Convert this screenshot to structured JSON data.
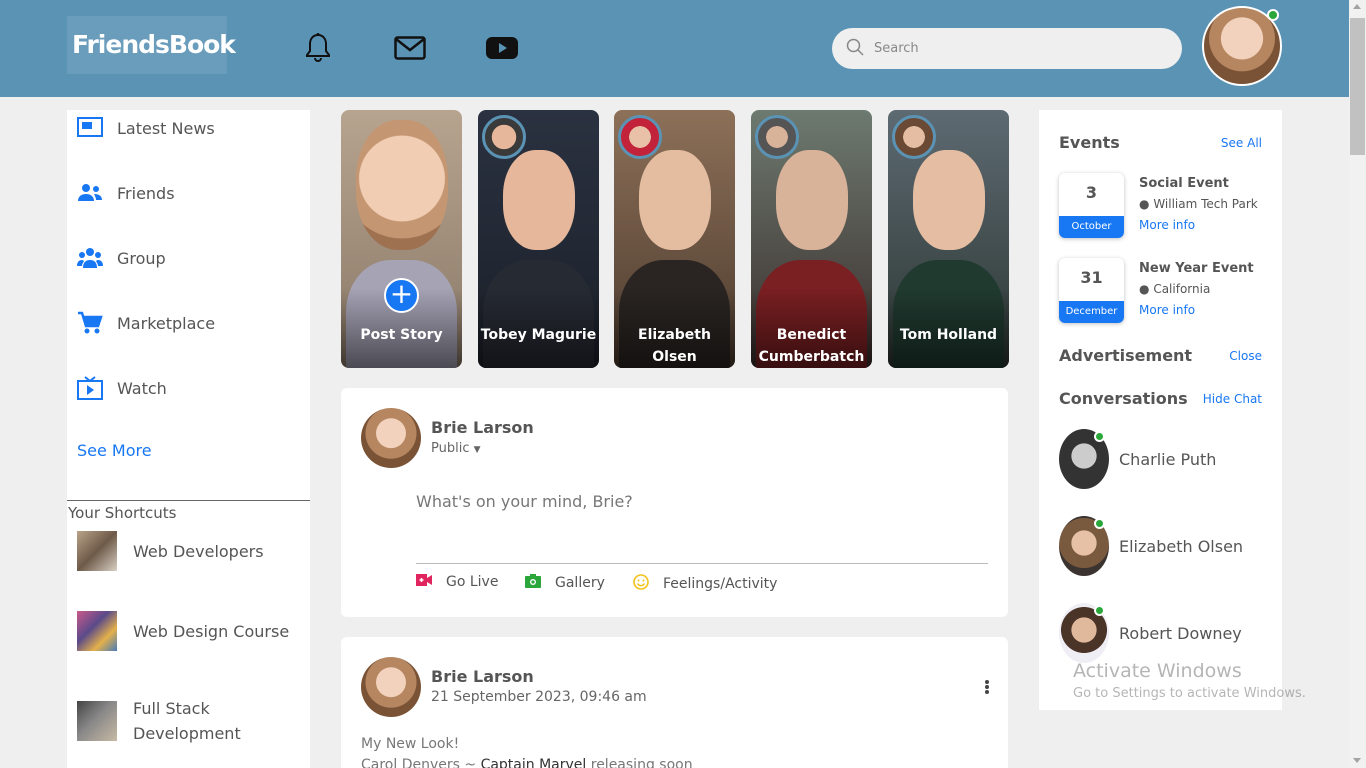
{
  "header": {
    "logo": "FriendsBook",
    "search_placeholder": "Search",
    "icons": [
      "bell-icon",
      "mail-icon",
      "youtube-icon"
    ]
  },
  "sidebar": {
    "items": [
      {
        "label": "Latest News",
        "icon": "news-icon"
      },
      {
        "label": "Friends",
        "icon": "friends-icon"
      },
      {
        "label": "Group",
        "icon": "group-icon"
      },
      {
        "label": "Marketplace",
        "icon": "cart-icon"
      },
      {
        "label": "Watch",
        "icon": "tv-icon"
      }
    ],
    "see_more": "See More",
    "shortcuts_title": "Your Shortcuts",
    "shortcuts": [
      {
        "label": "Web Developers"
      },
      {
        "label": "Web Design Course"
      },
      {
        "label": "Full Stack Development"
      }
    ]
  },
  "stories": [
    {
      "name": "Post Story"
    },
    {
      "name": "Tobey Magurie"
    },
    {
      "name": "Elizabeth Olsen"
    },
    {
      "name": "Benedict Cumberbatch"
    },
    {
      "name": "Tom Holland"
    }
  ],
  "create_post": {
    "user": "Brie Larson",
    "privacy": "Public",
    "placeholder": "What's on your mind, Brie?",
    "actions": [
      {
        "label": "Go Live",
        "icon": "live-video-icon",
        "color": "#e0245e"
      },
      {
        "label": "Gallery",
        "icon": "camera-icon",
        "color": "#2aa63b"
      },
      {
        "label": "Feelings/Activity",
        "icon": "smile-icon",
        "color": "#f2c21a"
      }
    ]
  },
  "post": {
    "user": "Brie Larson",
    "timestamp": "21 September 2023, 09:46 am",
    "text_line1": "My New Look!",
    "text_line2_prefix": "Carol Denvers ~ ",
    "text_line2_link": "Captain Marvel",
    "text_line2_suffix": " releasing soon"
  },
  "events": {
    "title": "Events",
    "see_all": "See All",
    "items": [
      {
        "day": "3",
        "month": "October",
        "title": "Social Event",
        "location": "William Tech Park",
        "more": "More info"
      },
      {
        "day": "31",
        "month": "December",
        "title": "New Year Event",
        "location": "California",
        "more": "More info"
      }
    ]
  },
  "advertisement": {
    "title": "Advertisement",
    "close": "Close"
  },
  "conversations": {
    "title": "Conversations",
    "hide": "Hide Chat",
    "items": [
      {
        "name": "Charlie Puth"
      },
      {
        "name": "Elizabeth Olsen"
      },
      {
        "name": "Robert Downey"
      }
    ]
  },
  "watermark": {
    "line1": "Activate Windows",
    "line2": "Go to Settings to activate Windows."
  },
  "colors": {
    "header": "#5b93b5",
    "accent": "#1877f2",
    "online": "#2aa63b"
  }
}
